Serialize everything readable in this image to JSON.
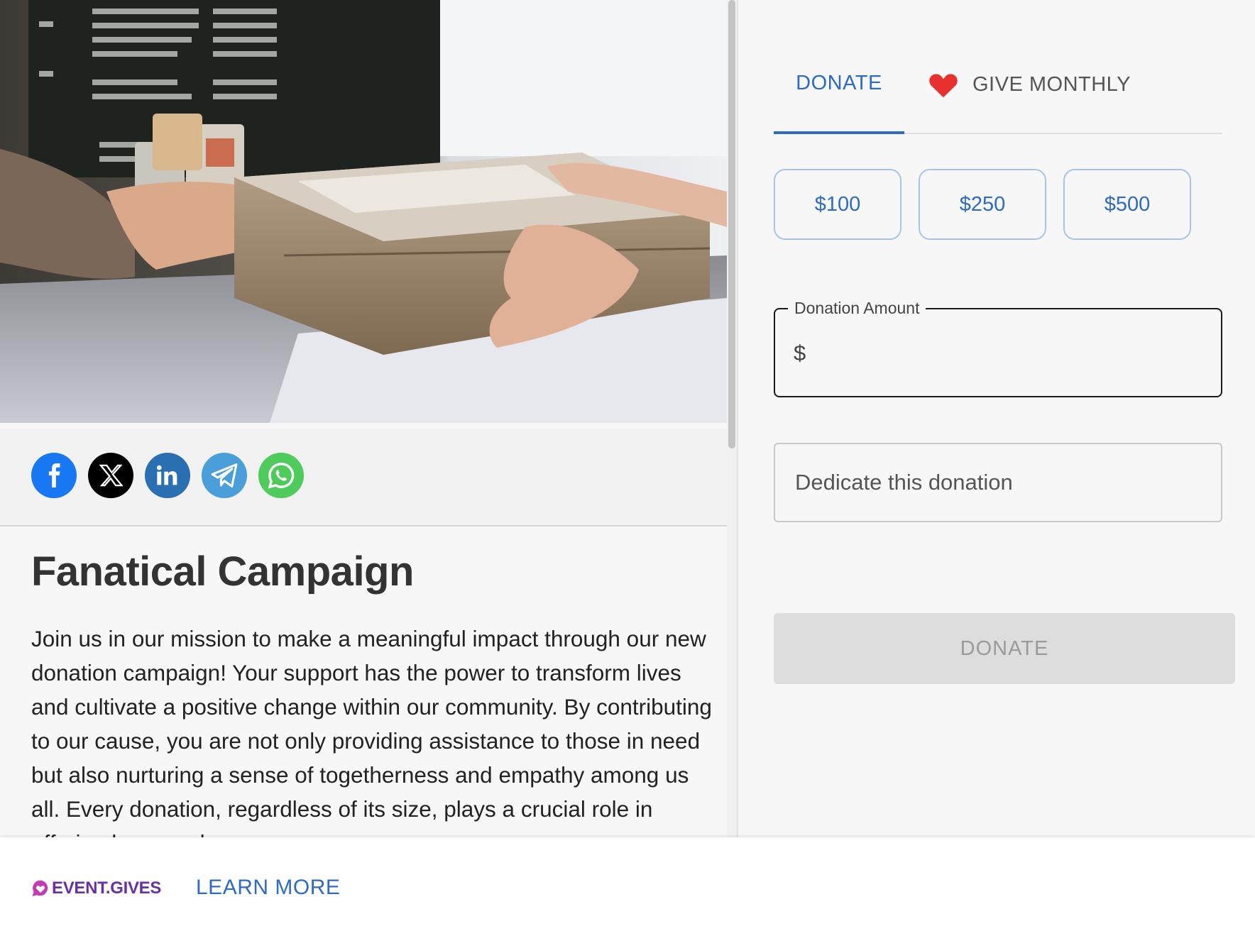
{
  "hero": {
    "image": "pizza-box-handoff-photo"
  },
  "share": {
    "buttons": [
      {
        "name": "facebook",
        "icon": "facebook-icon",
        "glyph": "f",
        "color": "#1877f2"
      },
      {
        "name": "x",
        "icon": "x-icon",
        "glyph": "𝕏",
        "color": "#000000"
      },
      {
        "name": "linkedin",
        "icon": "linkedin-icon",
        "glyph": "in",
        "color": "#2a6fb1"
      },
      {
        "name": "telegram",
        "icon": "telegram-icon",
        "color": "#4a9fdb"
      },
      {
        "name": "whatsapp",
        "icon": "whatsapp-icon",
        "color": "#4fcb5b"
      }
    ]
  },
  "campaign": {
    "title": "Fanatical Campaign",
    "description": "Join us in our mission to make a meaningful impact through our new donation campaign! Your support has the power to transform lives and cultivate a positive change within our community. By contributing to our cause, you are not only providing assistance to those in need but also nurturing a sense of togetherness and empathy among us all. Every donation, regardless of its size, plays a crucial role in offering hope and"
  },
  "tabs": {
    "donate": "DONATE",
    "monthly": "GIVE MONTHLY",
    "monthly_icon": "heart-icon",
    "active": "donate",
    "accent": "#2d6bc4",
    "heart_color": "#e8302e"
  },
  "amounts": [
    "$100",
    "$250",
    "$500"
  ],
  "donation_field": {
    "label": "Donation Amount",
    "prefix": "$",
    "value": ""
  },
  "dedicate": {
    "label": "Dedicate this donation"
  },
  "donate_button": {
    "label": "DONATE",
    "disabled": true
  },
  "footer": {
    "brand": "EVENT.GIVES",
    "brand_icon": "heart-chat-icon",
    "brand_color": "#6a2fa6",
    "learn_more": "LEARN MORE"
  }
}
